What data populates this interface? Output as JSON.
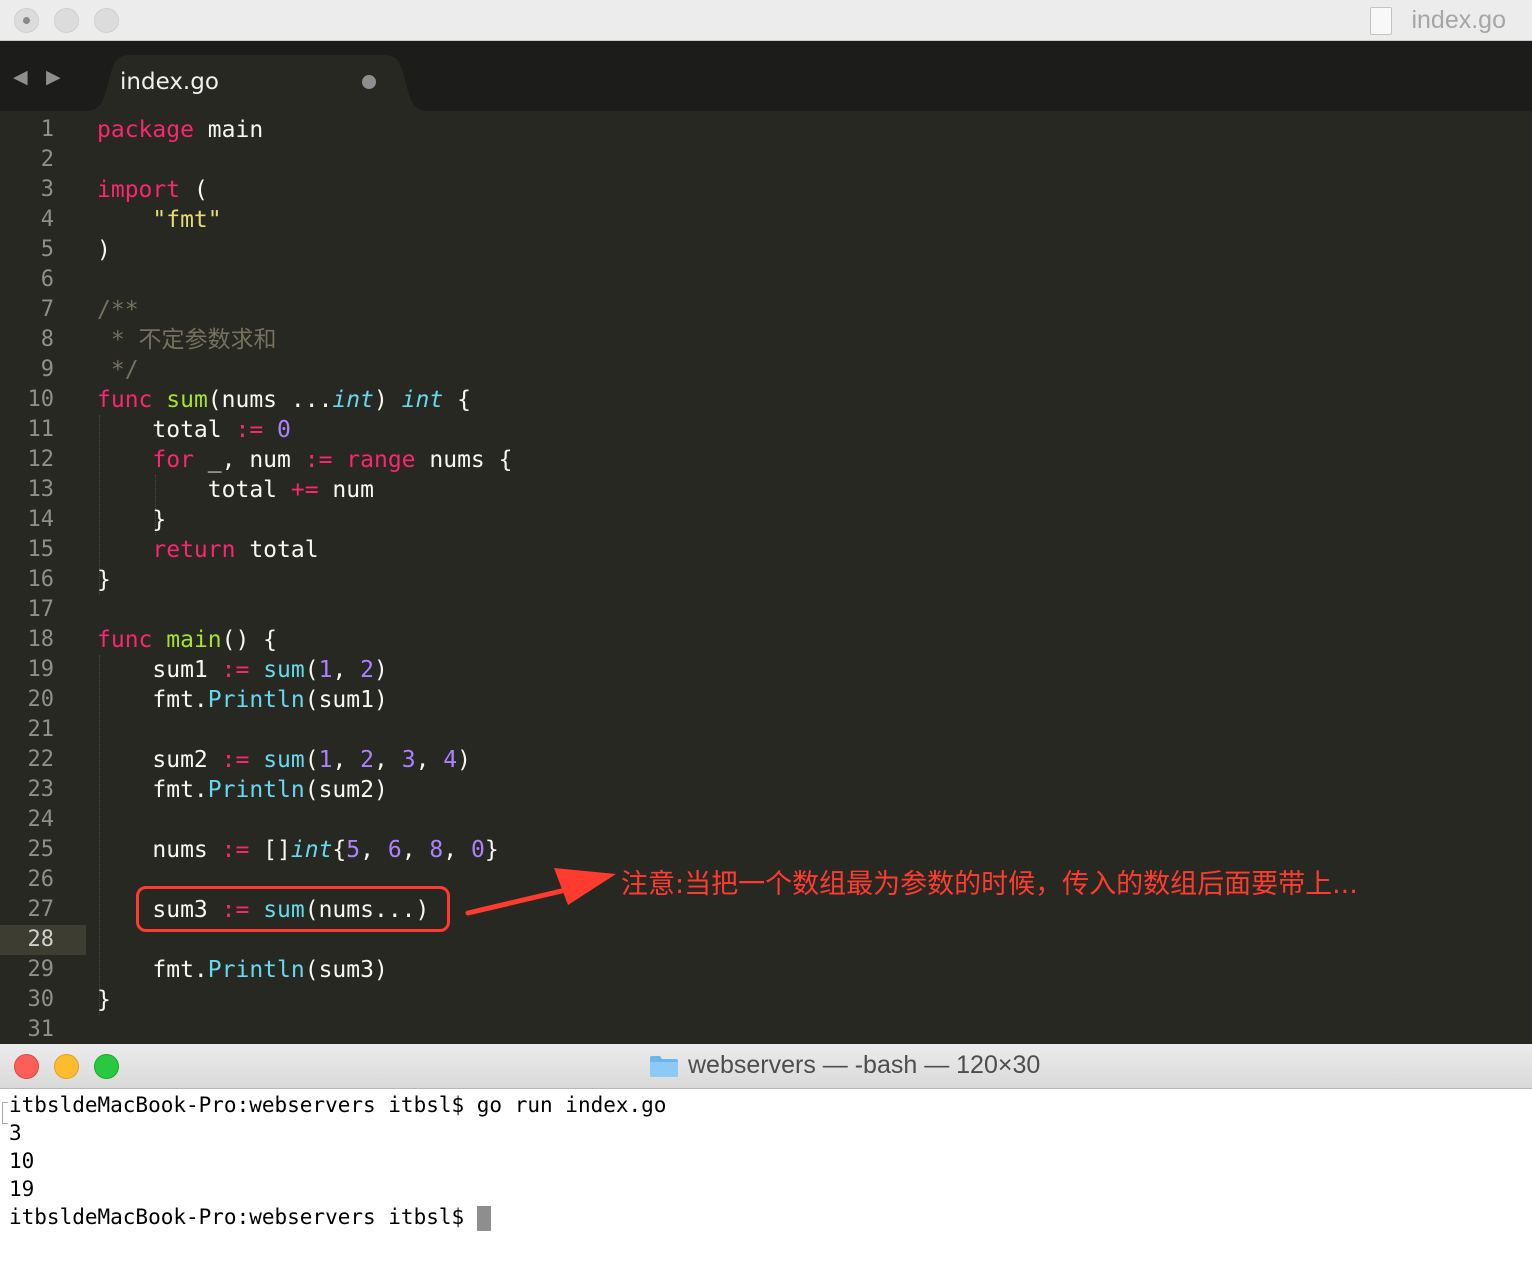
{
  "editor": {
    "window_title": "index.go",
    "nav_back": "◀",
    "nav_forward": "▶",
    "tab_label": "index.go",
    "current_line": 28,
    "line_numbers": [
      "1",
      "2",
      "3",
      "4",
      "5",
      "6",
      "7",
      "8",
      "9",
      "10",
      "11",
      "12",
      "13",
      "14",
      "15",
      "16",
      "17",
      "18",
      "19",
      "20",
      "21",
      "22",
      "23",
      "24",
      "25",
      "26",
      "27",
      "28",
      "29",
      "30",
      "31"
    ],
    "code": {
      "l1": [
        "package",
        " main"
      ],
      "l3": [
        "import",
        " ("
      ],
      "l4": [
        "    ",
        "\"fmt\""
      ],
      "l5": [
        ")"
      ],
      "l7": [
        "/**"
      ],
      "l8": [
        " * 不定参数求和"
      ],
      "l9": [
        " */"
      ],
      "l10": [
        "func",
        " ",
        "sum",
        "(nums ...",
        "int",
        ") ",
        "int",
        " {"
      ],
      "l11": [
        "    total ",
        ":=",
        " ",
        "0"
      ],
      "l12": [
        "    ",
        "for",
        " _, num ",
        ":=",
        " ",
        "range",
        " nums {"
      ],
      "l13": [
        "        total ",
        "+=",
        " num"
      ],
      "l14": [
        "    }"
      ],
      "l15": [
        "    ",
        "return",
        " total"
      ],
      "l16": [
        "}"
      ],
      "l18": [
        "func",
        " ",
        "main",
        "() {"
      ],
      "l19": [
        "    sum1 ",
        ":=",
        " ",
        "sum",
        "(",
        "1",
        ", ",
        "2",
        ")"
      ],
      "l20": [
        "    fmt.",
        "Println",
        "(sum1)"
      ],
      "l22": [
        "    sum2 ",
        ":=",
        " ",
        "sum",
        "(",
        "1",
        ", ",
        "2",
        ", ",
        "3",
        ", ",
        "4",
        ")"
      ],
      "l23": [
        "    fmt.",
        "Println",
        "(sum2)"
      ],
      "l25": [
        "    nums ",
        ":=",
        " []",
        "int",
        "{",
        "5",
        ", ",
        "6",
        ", ",
        "8",
        ", ",
        "0",
        "}"
      ],
      "l27": [
        "    sum3 ",
        ":=",
        " ",
        "sum",
        "(nums...)"
      ],
      "l29": [
        "    fmt.",
        "Println",
        "(sum3)"
      ],
      "l30": [
        "}"
      ]
    },
    "annotation": "注意:当把一个数组最为参数的时候，传入的数组后面要带上..."
  },
  "terminal": {
    "window_title": "webservers — -bash — 120×30",
    "lines": [
      "itbsldeMacBook-Pro:webservers itbsl$ go run index.go",
      "3",
      "10",
      "19",
      "itbsldeMacBook-Pro:webservers itbsl$ "
    ]
  },
  "colors": {
    "editor_bg": "#272822",
    "keyword": "#f92672",
    "string": "#e6db74",
    "comment": "#75715e",
    "function": "#a6e22e",
    "type": "#66d9ef",
    "number": "#ae81ff",
    "annotation_red": "#ff3b30"
  }
}
